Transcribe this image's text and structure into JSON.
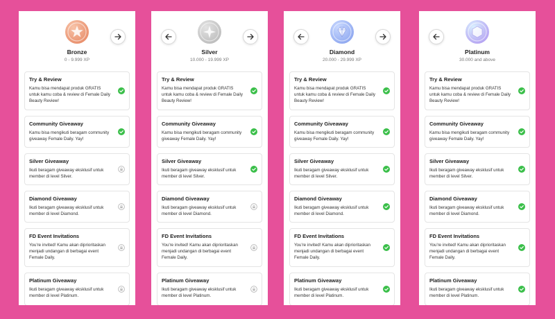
{
  "colors": {
    "background": "#e6509a",
    "check": "#3bbf4a",
    "lock": "#b8b8b8"
  },
  "panels": [
    {
      "tier": "Bronze",
      "range": "0 - 9.999 XP",
      "badge_colors": [
        "#f7c3a8",
        "#e98f6c"
      ],
      "badge_icon": "star-icon",
      "prev": false,
      "next": true,
      "statuses": [
        "check",
        "check",
        "lock",
        "lock",
        "lock",
        "lock"
      ]
    },
    {
      "tier": "Silver",
      "range": "10.000 - 19.999 XP",
      "badge_colors": [
        "#e3e3e3",
        "#bdbdbd"
      ],
      "badge_icon": "sparkle-icon",
      "prev": true,
      "next": true,
      "statuses": [
        "check",
        "check",
        "check",
        "lock",
        "lock",
        "lock"
      ]
    },
    {
      "tier": "Diamond",
      "range": "20.000 - 29.999 XP",
      "badge_colors": [
        "#c9d9ff",
        "#8fa8f0"
      ],
      "badge_icon": "diamond-icon",
      "prev": true,
      "next": true,
      "statuses": [
        "check",
        "check",
        "check",
        "check",
        "check",
        "check"
      ]
    },
    {
      "tier": "Platinum",
      "range": "30.000 and above",
      "badge_colors": [
        "#d9f0ff",
        "#b5a3f2"
      ],
      "badge_icon": "gem-icon",
      "prev": true,
      "next": false,
      "statuses": [
        "check",
        "check",
        "check",
        "check",
        "check",
        "check"
      ]
    }
  ],
  "benefits": [
    {
      "title": "Try & Review",
      "lines": [
        "Kamu bisa mendapat produk GRATIS",
        "untuk kamu coba & review di Female Daily",
        "Beauty Review!"
      ]
    },
    {
      "title": "Community Giveaway",
      "lines": [
        "Kamu bisa mengikuti beragam community",
        "giveaway Female Daily. Yay!"
      ]
    },
    {
      "title": "Silver Giveaway",
      "lines": [
        "Ikuti beragam giveaway eksklusif untuk",
        "member di level Silver."
      ]
    },
    {
      "title": "Diamond Giveaway",
      "lines": [
        "Ikuti beragam giveaway eksklusif untuk",
        "member di level Diamond."
      ]
    },
    {
      "title": "FD Event Invitations",
      "lines": [
        "You're invited! Kamu akan diprioritaskan",
        "menjadi undangan di berbagai event",
        "Female Daily."
      ]
    },
    {
      "title": "Platinum Giveaway",
      "lines": [
        "Ikuti beragam giveaway eksklusif untuk",
        "member di level Platinum."
      ]
    }
  ]
}
